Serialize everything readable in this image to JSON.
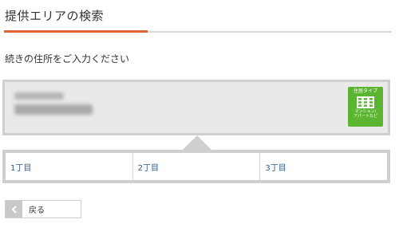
{
  "header": {
    "title": "提供エリアの検索"
  },
  "instruction": "続きの住所をご入力ください",
  "address_type_badge": {
    "label": "住居タイプ",
    "sub_line1": "マンション/",
    "sub_line2": "アパートなど",
    "color": "#5cb531",
    "icon": "building-grid-icon"
  },
  "choices": [
    {
      "label": "1丁目"
    },
    {
      "label": "2丁目"
    },
    {
      "label": "3丁目"
    }
  ],
  "back_button": {
    "label": "戻る",
    "icon": "chevron-left-icon"
  },
  "colors": {
    "accent": "#e0622f",
    "link": "#2a5f8f",
    "panel_border": "#cfcfcf"
  }
}
